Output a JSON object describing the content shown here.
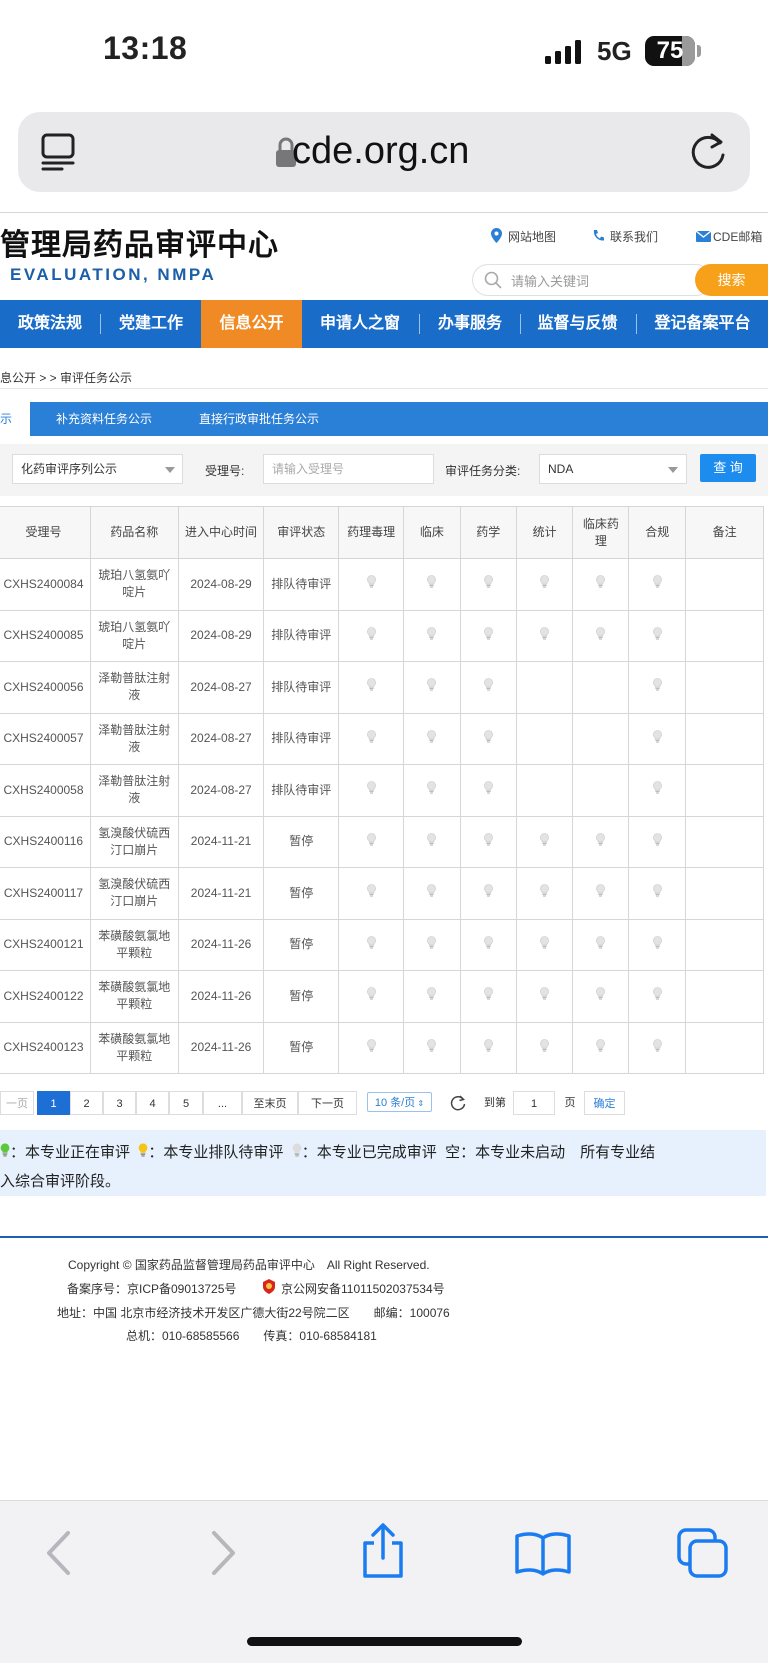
{
  "status_bar": {
    "time": "13:18",
    "network": "5G",
    "battery": "75"
  },
  "browser": {
    "url": "cde.org.cn"
  },
  "site": {
    "title": "管理局药品审评中心",
    "subtitle": "EVALUATION, NMPA",
    "links": [
      "网站地图",
      "联系我们",
      "CDE邮箱"
    ],
    "search_placeholder": "请输入关键词",
    "search_button": "搜索"
  },
  "nav": {
    "items": [
      "政策法规",
      "党建工作",
      "信息公开",
      "申请人之窗",
      "办事服务",
      "监督与反馈",
      "登记备案平台"
    ],
    "active": "信息公开"
  },
  "breadcrumb": "息公开 > > 审评任务公示",
  "tabs": [
    "示",
    "补充资料任务公示",
    "直接行政审批任务公示"
  ],
  "filter": {
    "sequence_value": "化药审评序列公示",
    "accept_label": "受理号:",
    "accept_placeholder": "请输入受理号",
    "category_label": "审评任务分类:",
    "category_value": "NDA",
    "query_button": "查 询"
  },
  "table": {
    "headers": [
      "受理号",
      "药品名称",
      "进入中心时间",
      "审评状态",
      "药理毒理",
      "临床",
      "药学",
      "统计",
      "临床药理",
      "合规",
      "备注"
    ],
    "rows": [
      {
        "id": "CXHS2400084",
        "name": "琥珀八氢氨吖啶片",
        "date": "2024-08-29",
        "status": "排队待审评",
        "marks": [
          1,
          1,
          1,
          1,
          1,
          1
        ]
      },
      {
        "id": "CXHS2400085",
        "name": "琥珀八氢氨吖啶片",
        "date": "2024-08-29",
        "status": "排队待审评",
        "marks": [
          1,
          1,
          1,
          1,
          1,
          1
        ]
      },
      {
        "id": "CXHS2400056",
        "name": "泽勒普肽注射液",
        "date": "2024-08-27",
        "status": "排队待审评",
        "marks": [
          1,
          1,
          1,
          0,
          0,
          1
        ]
      },
      {
        "id": "CXHS2400057",
        "name": "泽勒普肽注射液",
        "date": "2024-08-27",
        "status": "排队待审评",
        "marks": [
          1,
          1,
          1,
          0,
          0,
          1
        ]
      },
      {
        "id": "CXHS2400058",
        "name": "泽勒普肽注射液",
        "date": "2024-08-27",
        "status": "排队待审评",
        "marks": [
          1,
          1,
          1,
          0,
          0,
          1
        ]
      },
      {
        "id": "CXHS2400116",
        "name": "氢溴酸伏硫西汀口崩片",
        "date": "2024-11-21",
        "status": "暂停",
        "marks": [
          1,
          1,
          1,
          1,
          1,
          1
        ]
      },
      {
        "id": "CXHS2400117",
        "name": "氢溴酸伏硫西汀口崩片",
        "date": "2024-11-21",
        "status": "暂停",
        "marks": [
          1,
          1,
          1,
          1,
          1,
          1
        ]
      },
      {
        "id": "CXHS2400121",
        "name": "苯磺酸氨氯地平颗粒",
        "date": "2024-11-26",
        "status": "暂停",
        "marks": [
          1,
          1,
          1,
          1,
          1,
          1
        ]
      },
      {
        "id": "CXHS2400122",
        "name": "苯磺酸氨氯地平颗粒",
        "date": "2024-11-26",
        "status": "暂停",
        "marks": [
          1,
          1,
          1,
          1,
          1,
          1
        ]
      },
      {
        "id": "CXHS2400123",
        "name": "苯磺酸氨氯地平颗粒",
        "date": "2024-11-26",
        "status": "暂停",
        "marks": [
          1,
          1,
          1,
          1,
          1,
          1
        ]
      }
    ]
  },
  "pagination": {
    "prev_first": "一页",
    "pages": [
      "1",
      "2",
      "3",
      "4",
      "5",
      "..."
    ],
    "current": "1",
    "last": "至末页",
    "next": "下一页",
    "per_page": "10 条/页",
    "goto_label": "到第",
    "goto_value": "1",
    "page_unit": "页",
    "confirm": "确定"
  },
  "legend": {
    "line1": "：本专业正在审评 ：本专业排队待审评 ：本专业已完成审评 空：本专业未启动 所有专业结",
    "in_review": "：本专业正在审评",
    "queued": "：本专业排队待审评",
    "done": "：本专业已完成审评",
    "rest": "空：本专业未启动　所有专业结",
    "line2": "入综合审评阶段。"
  },
  "footer": {
    "copyright": "Copyright © 国家药品监督管理局药品审评中心　All Right Reserved.",
    "icp": "备案序号：京ICP备09013725号",
    "police": "京公网安备11011502037534号",
    "address": "地址：中国 北京市经济技术开发区广德大街22号院二区　　邮编：100076",
    "phone": "总机：010-68585566　　传真：010-68584181"
  },
  "colors": {
    "nav": "#1a6cc9",
    "active": "#f08a24",
    "search": "#f7a11a",
    "tab": "#2a7fd6",
    "legend_bg": "#e7f1fd"
  }
}
